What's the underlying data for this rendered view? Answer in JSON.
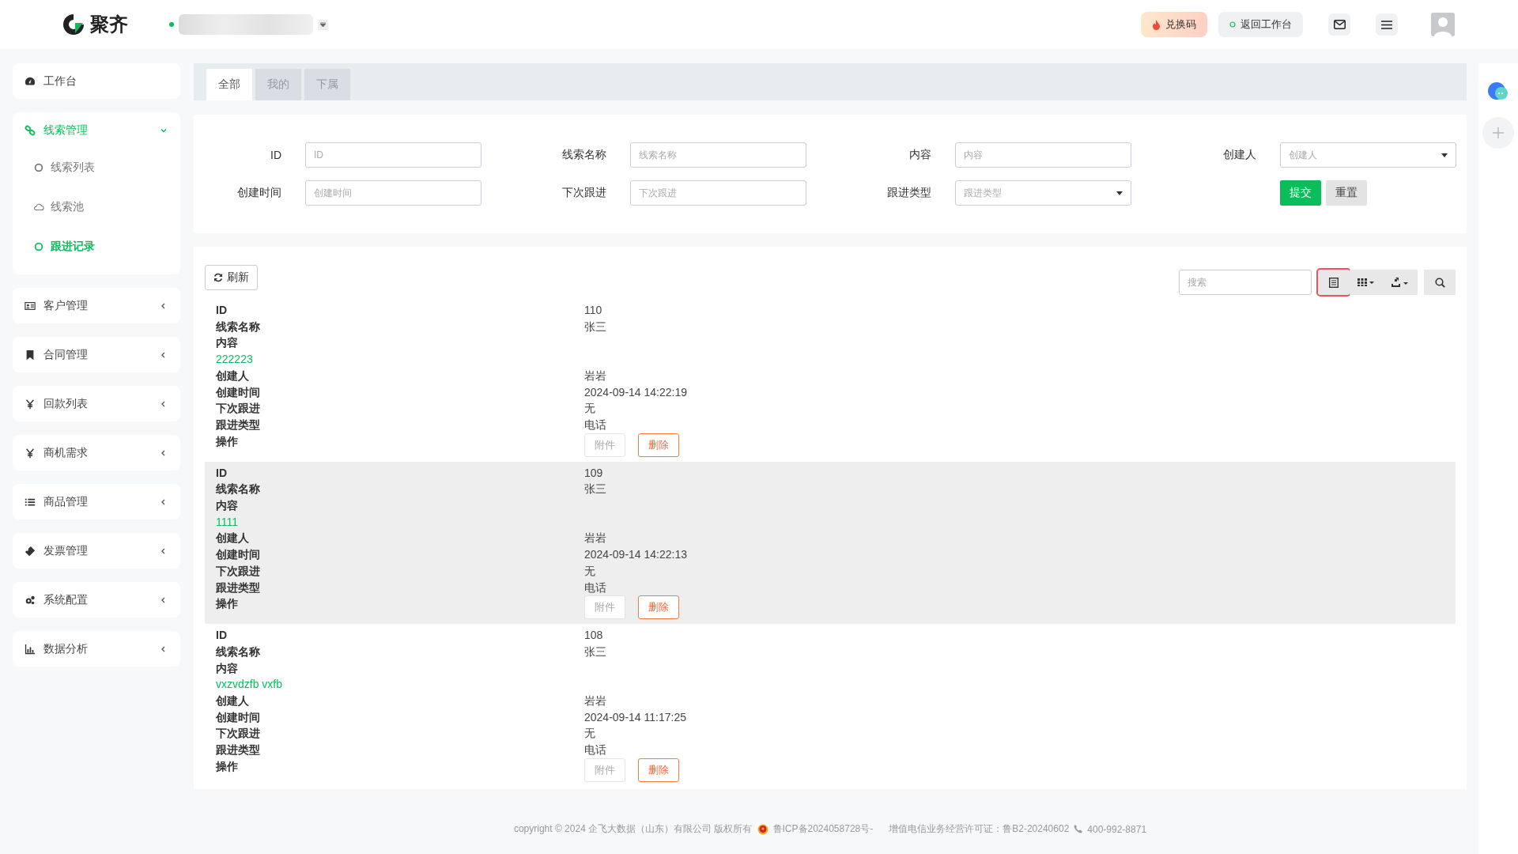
{
  "topbar": {
    "logo": "聚齐",
    "status_online": true,
    "actions": [
      {
        "kind": "redeem",
        "label": "兑换码"
      },
      {
        "kind": "back",
        "label": "返回工作台"
      }
    ]
  },
  "sidebar": {
    "items": [
      {
        "label": "工作台",
        "selected": false
      },
      {
        "label": "线索管理",
        "selected": true,
        "expanded": true,
        "children": [
          {
            "label": "线索列表",
            "selected": false
          },
          {
            "label": "线索池",
            "selected": false
          },
          {
            "label": "跟进记录",
            "selected": true
          }
        ]
      },
      {
        "label": "客户管理",
        "selected": false,
        "expanded": false
      },
      {
        "label": "合同管理",
        "selected": false,
        "expanded": false
      },
      {
        "label": "回款列表",
        "selected": false,
        "expanded": false
      },
      {
        "label": "商机需求",
        "selected": false,
        "expanded": false
      },
      {
        "label": "商品管理",
        "selected": false,
        "expanded": false
      },
      {
        "label": "发票管理",
        "selected": false,
        "expanded": false
      },
      {
        "label": "系统配置",
        "selected": false,
        "expanded": false
      },
      {
        "label": "数据分析",
        "selected": false,
        "expanded": false
      }
    ]
  },
  "tabs": [
    {
      "label": "全部",
      "selected": true
    },
    {
      "label": "我的",
      "selected": false
    },
    {
      "label": "下属",
      "selected": false
    }
  ],
  "filters": [
    {
      "label": "ID",
      "placeholder": "ID",
      "kind": "text"
    },
    {
      "label": "线索名称",
      "placeholder": "线索名称",
      "kind": "text"
    },
    {
      "label": "内容",
      "placeholder": "内容",
      "kind": "text"
    },
    {
      "label": "创建人",
      "placeholder": "创建人",
      "kind": "select"
    },
    {
      "label": "创建时间",
      "placeholder": "创建时间",
      "kind": "text"
    },
    {
      "label": "下次跟进",
      "placeholder": "下次跟进",
      "kind": "text"
    },
    {
      "label": "跟进类型",
      "placeholder": "跟进类型",
      "kind": "select"
    }
  ],
  "filter_buttons": [
    {
      "label": "提交",
      "kind": "primary"
    },
    {
      "label": "重置",
      "kind": "default"
    }
  ],
  "toolbar": {
    "refresh": "刷新",
    "search_placeholder": "搜索",
    "tools": [
      {
        "kind": "toggle-view",
        "selected": true
      },
      {
        "kind": "columns",
        "selected": false
      },
      {
        "kind": "export",
        "selected": false
      },
      {
        "kind": "search",
        "selected": false
      }
    ]
  },
  "records": [
    {
      "highlighted": false,
      "fields": [
        {
          "label": "ID",
          "value": "110"
        },
        {
          "label": "线索名称",
          "value": "张三"
        },
        {
          "label": "内容",
          "kind": "block",
          "value": "222223"
        },
        {
          "label": "创建人",
          "value": "岩岩"
        },
        {
          "label": "创建时间",
          "value": "2024-09-14 14:22:19"
        },
        {
          "label": "下次跟进",
          "value": "无"
        },
        {
          "label": "跟进类型",
          "value": "电话"
        },
        {
          "label": "操作",
          "kind": "actions",
          "actions": [
            {
              "label": "附件",
              "kind": "default",
              "disabled": true
            },
            {
              "label": "删除",
              "kind": "danger",
              "disabled": false
            }
          ]
        }
      ]
    },
    {
      "highlighted": true,
      "fields": [
        {
          "label": "ID",
          "value": "109"
        },
        {
          "label": "线索名称",
          "value": "张三"
        },
        {
          "label": "内容",
          "kind": "block",
          "value": "1111"
        },
        {
          "label": "创建人",
          "value": "岩岩"
        },
        {
          "label": "创建时间",
          "value": "2024-09-14 14:22:13"
        },
        {
          "label": "下次跟进",
          "value": "无"
        },
        {
          "label": "跟进类型",
          "value": "电话"
        },
        {
          "label": "操作",
          "kind": "actions",
          "actions": [
            {
              "label": "附件",
              "kind": "default",
              "disabled": true
            },
            {
              "label": "删除",
              "kind": "danger",
              "disabled": false
            }
          ]
        }
      ]
    },
    {
      "highlighted": false,
      "fields": [
        {
          "label": "ID",
          "value": "108"
        },
        {
          "label": "线索名称",
          "value": "张三"
        },
        {
          "label": "内容",
          "kind": "block",
          "value": "vxzvdzfb vxfb"
        },
        {
          "label": "创建人",
          "value": "岩岩"
        },
        {
          "label": "创建时间",
          "value": "2024-09-14 11:17:25"
        },
        {
          "label": "下次跟进",
          "value": "无"
        },
        {
          "label": "跟进类型",
          "value": "电话"
        },
        {
          "label": "操作",
          "kind": "actions",
          "actions": [
            {
              "label": "附件",
              "kind": "default",
              "disabled": true
            },
            {
              "label": "删除",
              "kind": "danger",
              "disabled": false
            }
          ]
        }
      ]
    }
  ],
  "footer": {
    "copyright": "copyright © 2024 企飞大数据（山东）有限公司 版权所有",
    "icp": "鲁ICP备2024058728号-",
    "license": "增值电信业务经营许可证：鲁B2-20240602",
    "phone": "400-992-8871"
  }
}
